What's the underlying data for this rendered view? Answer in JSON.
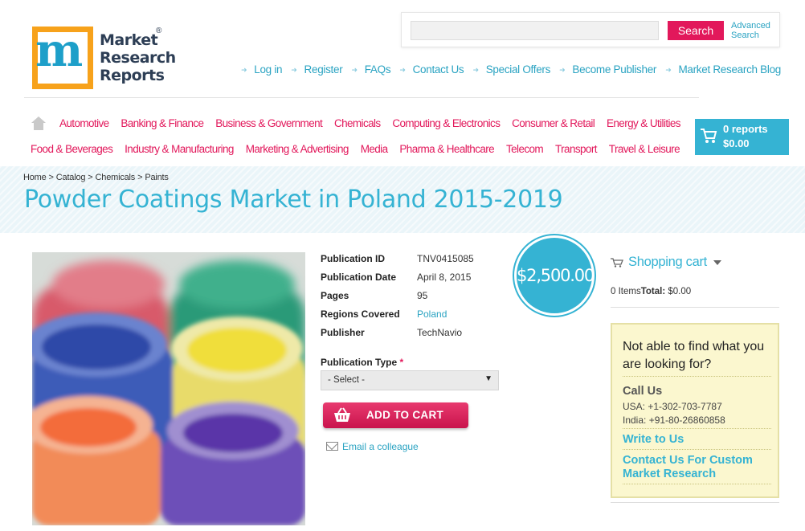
{
  "logo": {
    "letter": "m",
    "line1": "Market",
    "line2": "Research",
    "line3": "Reports",
    "reg": "®"
  },
  "search": {
    "placeholder": "",
    "button_label": "Search",
    "advanced_label_1": "Advanced",
    "advanced_label_2": "Search"
  },
  "top_links": [
    "Log in",
    "Register",
    "FAQs",
    "Contact Us",
    "Special Offers",
    "Become Publisher",
    "Market Research Blog"
  ],
  "categories_row1": [
    "Automotive",
    "Banking & Finance",
    "Business & Government",
    "Chemicals",
    "Computing & Electronics",
    "Consumer & Retail",
    "Energy & Utilities"
  ],
  "categories_row2": [
    "Food & Beverages",
    "Industry & Manufacturing",
    "Marketing & Advertising",
    "Media",
    "Pharma & Healthcare",
    "Telecom",
    "Transport",
    "Travel & Leisure"
  ],
  "cart_widget": {
    "reports": "0 reports",
    "total": "$0.00"
  },
  "breadcrumb": [
    "Home",
    "Catalog",
    "Chemicals",
    "Paints"
  ],
  "page_title": "Powder Coatings Market in Poland 2015-2019",
  "details": {
    "publication_id_label": "Publication ID",
    "publication_id": "TNV0415085",
    "publication_date_label": "Publication Date",
    "publication_date": "April 8, 2015",
    "pages_label": "Pages",
    "pages": "95",
    "regions_label": "Regions Covered",
    "regions": "Poland",
    "publisher_label": "Publisher",
    "publisher": "TechNavio"
  },
  "publication_type": {
    "label": "Publication Type",
    "required_mark": "*",
    "selected": "- Select -"
  },
  "add_to_cart_label": "ADD TO CART",
  "email_colleague_label": "Email a colleague",
  "price": "$2,500.00",
  "shopping_cart": {
    "title": "Shopping cart",
    "items_label": "0 Items",
    "total_label": "Total:",
    "total_value": "$0.00"
  },
  "help_box": {
    "heading": "Not able to find what you are looking for?",
    "call_us": "Call Us",
    "usa": "USA: +1-302-703-7787",
    "india": "India: +91-80-26860858",
    "write_to_us": "Write to Us",
    "custom": "Contact Us For Custom Market Research"
  },
  "colors": {
    "accent_blue": "#35b3d3",
    "accent_pink": "#e2185b",
    "logo_orange": "#f7a21b",
    "help_bg": "#fbf7cf"
  },
  "icons": [
    "home-icon",
    "cart-icon",
    "basket-icon",
    "envelope-icon",
    "chevron-down-icon",
    "arrow-icon"
  ]
}
